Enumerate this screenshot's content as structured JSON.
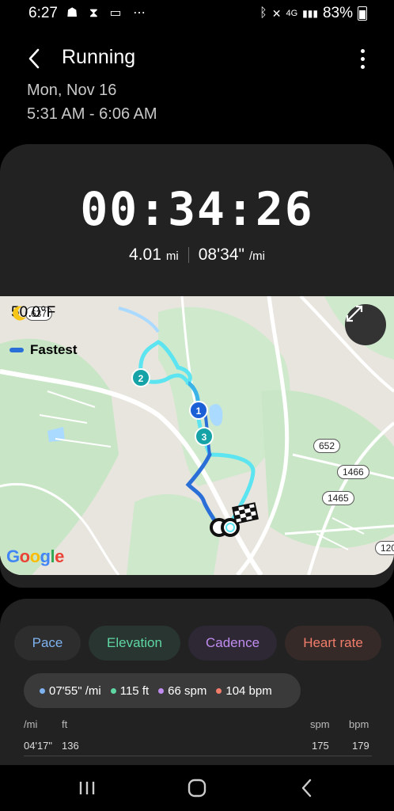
{
  "status_bar": {
    "time": "6:27",
    "battery": "83%",
    "icons": [
      "running-notification-icon",
      "hourglass-icon",
      "message-icon",
      "more-notifications-icon",
      "bluetooth-icon",
      "mute-icon",
      "4g-lte-icon",
      "signal-icon",
      "battery-icon"
    ]
  },
  "app_bar": {
    "title": "Running"
  },
  "header": {
    "date": "Mon, Nov 16",
    "time_range": "5:31 AM - 6:06 AM"
  },
  "stats": {
    "duration": "00:34:26",
    "distance_value": "4.01",
    "distance_unit": "mi",
    "pace_value": "08'34\"",
    "pace_unit": "/mi"
  },
  "map": {
    "temperature": "50.0°F",
    "legend_label": "Fastest",
    "attribution": [
      "G",
      "o",
      "o",
      "g",
      "l",
      "e"
    ],
    "road_labels": [
      "637",
      "652",
      "1466",
      "1465",
      "120"
    ],
    "markers": [
      "1",
      "2",
      "3"
    ],
    "colors": {
      "fastest": "#2a6fd8",
      "route_light": "#5ce5f0",
      "route_mid": "#3bb3e6",
      "marker": "#16a3a8",
      "marker_1": "#1a5fd6"
    }
  },
  "chart_tabs": [
    {
      "label": "Pace",
      "color": "#7fb2f0"
    },
    {
      "label": "Elevation",
      "color": "#5fd7a4"
    },
    {
      "label": "Cadence",
      "color": "#c08cf0"
    },
    {
      "label": "Heart rate",
      "color": "#f27d6b"
    }
  ],
  "readout": {
    "pace": "07'55\" /mi",
    "elevation": "115 ft",
    "cadence": "66 spm",
    "heart_rate": "104 bpm"
  },
  "chart_axes": {
    "pace_unit": "/mi",
    "elevation_unit": "ft",
    "cadence_unit": "spm",
    "heart_unit": "bpm",
    "pace_top": "04'17\"",
    "elevation_top": "136",
    "cadence_top": "175",
    "heart_top": "179"
  }
}
